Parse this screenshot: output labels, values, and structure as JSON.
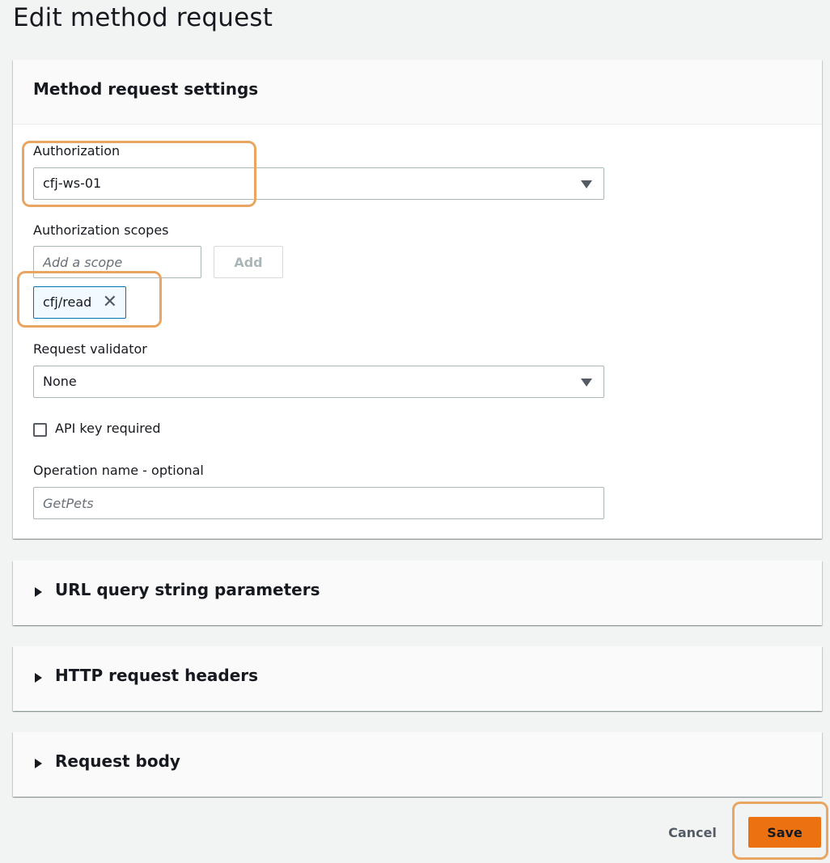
{
  "page": {
    "title": "Edit method request"
  },
  "settings": {
    "header": "Method request settings",
    "authorization": {
      "label": "Authorization",
      "value": "cfj-ws-01",
      "icon": "caret-down-icon"
    },
    "scopes": {
      "label": "Authorization scopes",
      "placeholder": "Add a scope",
      "add_label": "Add",
      "tokens": [
        {
          "label": "cfj/read",
          "icon": "close-icon"
        }
      ]
    },
    "validator": {
      "label": "Request validator",
      "value": "None",
      "icon": "caret-down-icon"
    },
    "api_key": {
      "label": "API key required",
      "checked": false
    },
    "operation_name": {
      "label": "Operation name - optional",
      "placeholder": "GetPets",
      "value": ""
    }
  },
  "sections": [
    {
      "title": "URL query string parameters",
      "expanded": false
    },
    {
      "title": "HTTP request headers",
      "expanded": false
    },
    {
      "title": "Request body",
      "expanded": false
    }
  ],
  "footer": {
    "cancel_label": "Cancel",
    "save_label": "Save"
  },
  "colors": {
    "primary": "#ec7211",
    "highlight": "#e8a662",
    "token_border": "#0073bb",
    "token_background": "#f1faff",
    "page_background": "#f2f3f3"
  }
}
